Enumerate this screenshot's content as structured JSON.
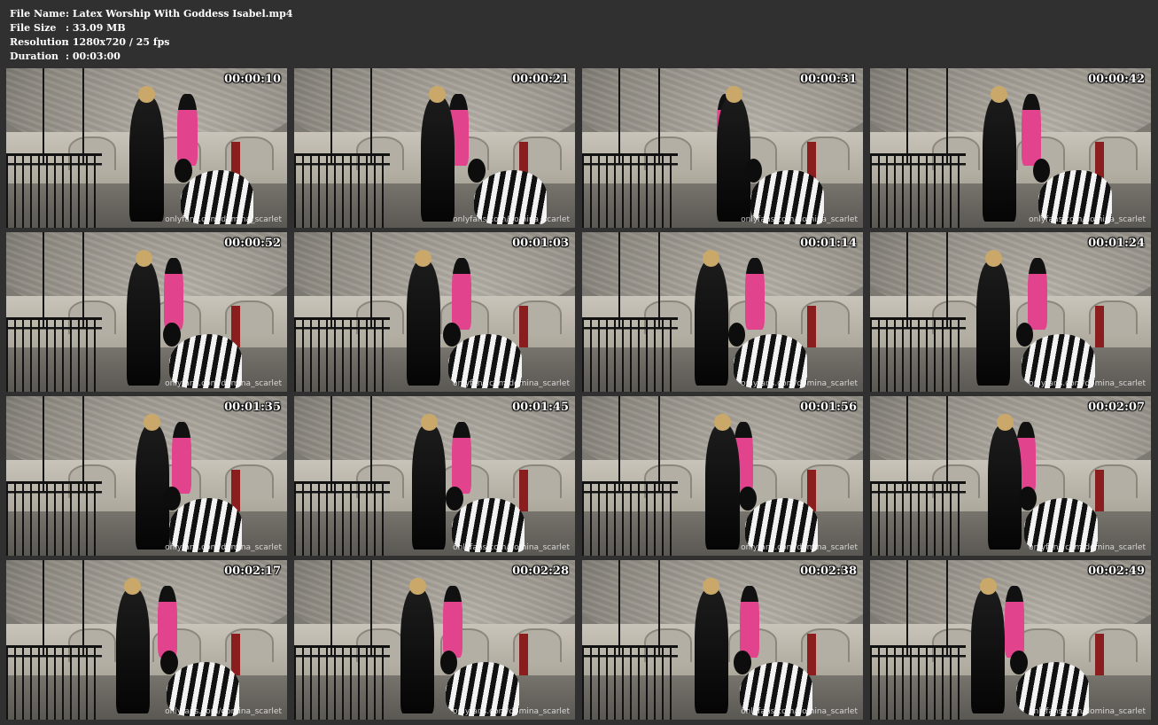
{
  "meta": [
    {
      "key": "File Name",
      "sep": ":",
      "value": "Latex Worship With Goddess Isabel.mp4"
    },
    {
      "key": "File Size",
      "sep": ":",
      "value": "33.09 MB"
    },
    {
      "key": "Resolution",
      "sep": ":",
      "value": "1280x720 / 25 fps"
    },
    {
      "key": "Duration",
      "sep": ":",
      "value": "00:03:00"
    }
  ],
  "watermark_text": "onlyfans.com/domina_scarlet",
  "thumbnails": [
    {
      "timestamp": "00:00:10"
    },
    {
      "timestamp": "00:00:21"
    },
    {
      "timestamp": "00:00:31"
    },
    {
      "timestamp": "00:00:42"
    },
    {
      "timestamp": "00:00:52"
    },
    {
      "timestamp": "00:01:03"
    },
    {
      "timestamp": "00:01:14"
    },
    {
      "timestamp": "00:01:24"
    },
    {
      "timestamp": "00:01:35"
    },
    {
      "timestamp": "00:01:45"
    },
    {
      "timestamp": "00:01:56"
    },
    {
      "timestamp": "00:02:07"
    },
    {
      "timestamp": "00:02:17"
    },
    {
      "timestamp": "00:02:28"
    },
    {
      "timestamp": "00:02:38"
    },
    {
      "timestamp": "00:02:49"
    }
  ]
}
